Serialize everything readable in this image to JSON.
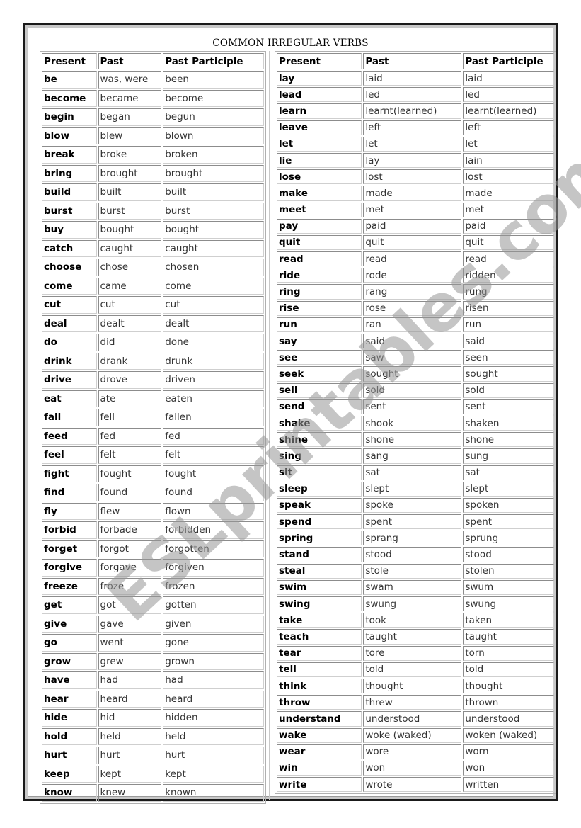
{
  "title": "COMMON IRREGULAR VERBS",
  "watermark": "ESLprintables.com",
  "headers": [
    "Present",
    "Past",
    "Past Participle"
  ],
  "left_table": [
    [
      "be",
      "was, were",
      "been"
    ],
    [
      "become",
      "became",
      "become"
    ],
    [
      "begin",
      "began",
      "begun"
    ],
    [
      "blow",
      "blew",
      "blown"
    ],
    [
      "break",
      "broke",
      "broken"
    ],
    [
      "bring",
      "brought",
      "brought"
    ],
    [
      "build",
      "built",
      "built"
    ],
    [
      "burst",
      "burst",
      "burst"
    ],
    [
      "buy",
      "bought",
      "bought"
    ],
    [
      "catch",
      "caught",
      "caught"
    ],
    [
      "choose",
      "chose",
      "chosen"
    ],
    [
      "come",
      "came",
      "come"
    ],
    [
      "cut",
      "cut",
      "cut"
    ],
    [
      "deal",
      "dealt",
      "dealt"
    ],
    [
      "do",
      "did",
      "done"
    ],
    [
      "drink",
      "drank",
      "drunk"
    ],
    [
      "drive",
      "drove",
      "driven"
    ],
    [
      "eat",
      "ate",
      "eaten"
    ],
    [
      "fall",
      "fell",
      "fallen"
    ],
    [
      "feed",
      "fed",
      "fed"
    ],
    [
      "feel",
      "felt",
      "felt"
    ],
    [
      "fight",
      "fought",
      "fought"
    ],
    [
      "find",
      "found",
      "found"
    ],
    [
      "fly",
      "flew",
      "flown"
    ],
    [
      "forbid",
      "forbade",
      "forbidden"
    ],
    [
      "forget",
      "forgot",
      "forgotten"
    ],
    [
      "forgive",
      "forgave",
      "forgiven"
    ],
    [
      "freeze",
      "froze",
      "frozen"
    ],
    [
      "get",
      "got",
      "gotten"
    ],
    [
      "give",
      "gave",
      "given"
    ],
    [
      "go",
      "went",
      "gone"
    ],
    [
      "grow",
      "grew",
      "grown"
    ],
    [
      "have",
      "had",
      "had"
    ],
    [
      "hear",
      "heard",
      "heard"
    ],
    [
      "hide",
      "hid",
      "hidden"
    ],
    [
      "hold",
      "held",
      "held"
    ],
    [
      "hurt",
      "hurt",
      "hurt"
    ],
    [
      "keep",
      "kept",
      "kept"
    ],
    [
      "know",
      "knew",
      "known"
    ]
  ],
  "right_table": [
    [
      "lay",
      "laid",
      "laid"
    ],
    [
      "lead",
      "led",
      "led"
    ],
    [
      "learn",
      "learnt(learned)",
      "learnt(learned)"
    ],
    [
      "leave",
      "left",
      "left"
    ],
    [
      "let",
      "let",
      "let"
    ],
    [
      "lie",
      "lay",
      "lain"
    ],
    [
      "lose",
      "lost",
      "lost"
    ],
    [
      "make",
      "made",
      "made"
    ],
    [
      "meet",
      "met",
      "met"
    ],
    [
      "pay",
      "paid",
      "paid"
    ],
    [
      "quit",
      "quit",
      "quit"
    ],
    [
      "read",
      "read",
      "read"
    ],
    [
      "ride",
      "rode",
      "ridden"
    ],
    [
      "ring",
      "rang",
      "rung"
    ],
    [
      "rise",
      "rose",
      "risen"
    ],
    [
      "run",
      "ran",
      "run"
    ],
    [
      "say",
      "said",
      "said"
    ],
    [
      "see",
      "saw",
      "seen"
    ],
    [
      "seek",
      "sought",
      "sought"
    ],
    [
      "sell",
      "sold",
      "sold"
    ],
    [
      "send",
      "sent",
      "sent"
    ],
    [
      "shake",
      "shook",
      "shaken"
    ],
    [
      "shine",
      "shone",
      "shone"
    ],
    [
      "sing",
      "sang",
      "sung"
    ],
    [
      "sit",
      "sat",
      "sat"
    ],
    [
      "sleep",
      "slept",
      "slept"
    ],
    [
      "speak",
      "spoke",
      "spoken"
    ],
    [
      "spend",
      "spent",
      "spent"
    ],
    [
      "spring",
      "sprang",
      "sprung"
    ],
    [
      "stand",
      "stood",
      "stood"
    ],
    [
      "steal",
      "stole",
      "stolen"
    ],
    [
      "swim",
      "swam",
      "swum"
    ],
    [
      "swing",
      "swung",
      "swung"
    ],
    [
      "take",
      "took",
      "taken"
    ],
    [
      "teach",
      "taught",
      "taught"
    ],
    [
      "tear",
      "tore",
      "torn"
    ],
    [
      "tell",
      "told",
      "told"
    ],
    [
      "think",
      "thought",
      "thought"
    ],
    [
      "throw",
      "threw",
      "thrown"
    ],
    [
      "understand",
      "understood",
      "understood"
    ],
    [
      "wake",
      "woke (waked)",
      "woken (waked)"
    ],
    [
      "wear",
      "wore",
      "worn"
    ],
    [
      "win",
      "won",
      "won"
    ],
    [
      "write",
      "wrote",
      "written"
    ]
  ]
}
